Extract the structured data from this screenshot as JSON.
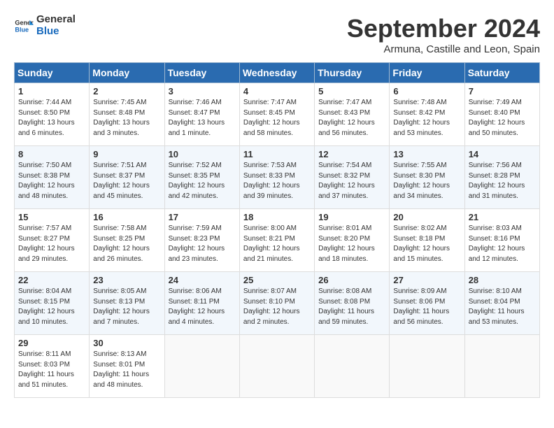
{
  "header": {
    "logo_line1": "General",
    "logo_line2": "Blue",
    "month": "September 2024",
    "location": "Armuna, Castille and Leon, Spain"
  },
  "days_of_week": [
    "Sunday",
    "Monday",
    "Tuesday",
    "Wednesday",
    "Thursday",
    "Friday",
    "Saturday"
  ],
  "weeks": [
    [
      {
        "day": "1",
        "sunrise": "7:44 AM",
        "sunset": "8:50 PM",
        "daylight": "13 hours and 6 minutes."
      },
      {
        "day": "2",
        "sunrise": "7:45 AM",
        "sunset": "8:48 PM",
        "daylight": "13 hours and 3 minutes."
      },
      {
        "day": "3",
        "sunrise": "7:46 AM",
        "sunset": "8:47 PM",
        "daylight": "13 hours and 1 minute."
      },
      {
        "day": "4",
        "sunrise": "7:47 AM",
        "sunset": "8:45 PM",
        "daylight": "12 hours and 58 minutes."
      },
      {
        "day": "5",
        "sunrise": "7:47 AM",
        "sunset": "8:43 PM",
        "daylight": "12 hours and 56 minutes."
      },
      {
        "day": "6",
        "sunrise": "7:48 AM",
        "sunset": "8:42 PM",
        "daylight": "12 hours and 53 minutes."
      },
      {
        "day": "7",
        "sunrise": "7:49 AM",
        "sunset": "8:40 PM",
        "daylight": "12 hours and 50 minutes."
      }
    ],
    [
      {
        "day": "8",
        "sunrise": "7:50 AM",
        "sunset": "8:38 PM",
        "daylight": "12 hours and 48 minutes."
      },
      {
        "day": "9",
        "sunrise": "7:51 AM",
        "sunset": "8:37 PM",
        "daylight": "12 hours and 45 minutes."
      },
      {
        "day": "10",
        "sunrise": "7:52 AM",
        "sunset": "8:35 PM",
        "daylight": "12 hours and 42 minutes."
      },
      {
        "day": "11",
        "sunrise": "7:53 AM",
        "sunset": "8:33 PM",
        "daylight": "12 hours and 39 minutes."
      },
      {
        "day": "12",
        "sunrise": "7:54 AM",
        "sunset": "8:32 PM",
        "daylight": "12 hours and 37 minutes."
      },
      {
        "day": "13",
        "sunrise": "7:55 AM",
        "sunset": "8:30 PM",
        "daylight": "12 hours and 34 minutes."
      },
      {
        "day": "14",
        "sunrise": "7:56 AM",
        "sunset": "8:28 PM",
        "daylight": "12 hours and 31 minutes."
      }
    ],
    [
      {
        "day": "15",
        "sunrise": "7:57 AM",
        "sunset": "8:27 PM",
        "daylight": "12 hours and 29 minutes."
      },
      {
        "day": "16",
        "sunrise": "7:58 AM",
        "sunset": "8:25 PM",
        "daylight": "12 hours and 26 minutes."
      },
      {
        "day": "17",
        "sunrise": "7:59 AM",
        "sunset": "8:23 PM",
        "daylight": "12 hours and 23 minutes."
      },
      {
        "day": "18",
        "sunrise": "8:00 AM",
        "sunset": "8:21 PM",
        "daylight": "12 hours and 21 minutes."
      },
      {
        "day": "19",
        "sunrise": "8:01 AM",
        "sunset": "8:20 PM",
        "daylight": "12 hours and 18 minutes."
      },
      {
        "day": "20",
        "sunrise": "8:02 AM",
        "sunset": "8:18 PM",
        "daylight": "12 hours and 15 minutes."
      },
      {
        "day": "21",
        "sunrise": "8:03 AM",
        "sunset": "8:16 PM",
        "daylight": "12 hours and 12 minutes."
      }
    ],
    [
      {
        "day": "22",
        "sunrise": "8:04 AM",
        "sunset": "8:15 PM",
        "daylight": "12 hours and 10 minutes."
      },
      {
        "day": "23",
        "sunrise": "8:05 AM",
        "sunset": "8:13 PM",
        "daylight": "12 hours and 7 minutes."
      },
      {
        "day": "24",
        "sunrise": "8:06 AM",
        "sunset": "8:11 PM",
        "daylight": "12 hours and 4 minutes."
      },
      {
        "day": "25",
        "sunrise": "8:07 AM",
        "sunset": "8:10 PM",
        "daylight": "12 hours and 2 minutes."
      },
      {
        "day": "26",
        "sunrise": "8:08 AM",
        "sunset": "8:08 PM",
        "daylight": "11 hours and 59 minutes."
      },
      {
        "day": "27",
        "sunrise": "8:09 AM",
        "sunset": "8:06 PM",
        "daylight": "11 hours and 56 minutes."
      },
      {
        "day": "28",
        "sunrise": "8:10 AM",
        "sunset": "8:04 PM",
        "daylight": "11 hours and 53 minutes."
      }
    ],
    [
      {
        "day": "29",
        "sunrise": "8:11 AM",
        "sunset": "8:03 PM",
        "daylight": "11 hours and 51 minutes."
      },
      {
        "day": "30",
        "sunrise": "8:13 AM",
        "sunset": "8:01 PM",
        "daylight": "11 hours and 48 minutes."
      },
      null,
      null,
      null,
      null,
      null
    ]
  ]
}
